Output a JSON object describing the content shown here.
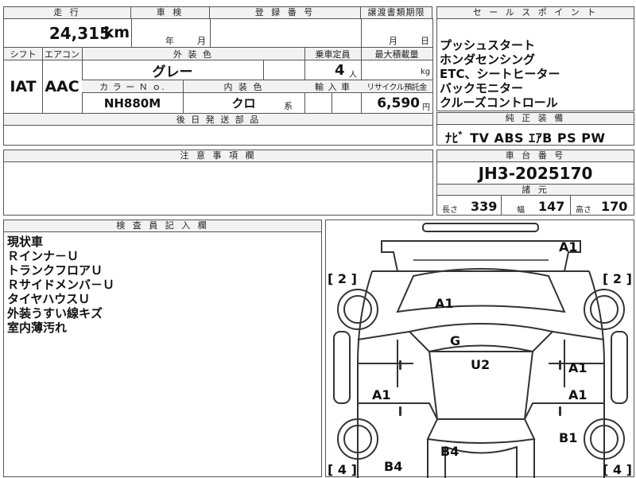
{
  "header": {
    "mileage_label": "走 行",
    "shaken_label": "車 検",
    "reg_label": "登 録 番 号",
    "transfer_label": "譲渡書類期限",
    "sales_point_label": "セ ー ル ス ポ イ ン ト"
  },
  "mileage": {
    "value": "24,315",
    "unit": "km"
  },
  "shaken": {
    "year_unit": "年",
    "month_unit": "月"
  },
  "transfer": {
    "month_unit": "月",
    "day_unit": "日"
  },
  "labels": {
    "shift": "シフト",
    "aircon": "エアコン",
    "exterior_color": "外 装 色",
    "capacity": "乗車定員",
    "max_load": "最大積載量",
    "color_no": "カ ラ ー Ｎ ｏ.",
    "interior_color": "内 装 色",
    "import": "輸 入 車",
    "recycle": "リサイクル預託金",
    "later_parts": "後 日 発 送 部 品",
    "standard_equipment": "純 正 装 備",
    "notes": "注 意 事 項 欄",
    "chassis": "車 台 番 号",
    "specs": "諸 元",
    "inspector": "検 査 員 記 入 欄"
  },
  "vehicle": {
    "shift": "IAT",
    "aircon": "AAC",
    "exterior_color": "グレー",
    "capacity": "4",
    "capacity_unit": "人",
    "max_load_unit": "kg",
    "color_no": "NH880M",
    "interior_color": "クロ",
    "interior_suffix": "系",
    "recycle_fee": "6,590",
    "recycle_unit": "円"
  },
  "sales_points": [
    "プッシュスタート",
    "ホンダセンシング",
    "ETC、シートヒーター",
    "バックモニター",
    "クルーズコントロール"
  ],
  "equipment": "ﾅﾋﾞ TV ABS ｴｱB PS PW",
  "chassis_no": "JH3-2025170",
  "dimensions": {
    "length_label": "長さ",
    "length": "339",
    "width_label": "幅",
    "width": "147",
    "height_label": "高さ",
    "height": "170"
  },
  "inspector_notes": [
    "現状車",
    "Ｒインナ－Ｕ",
    "トランクフロアＵ",
    "Ｒサイドメンバ－Ｕ",
    "タイヤハウスＵ",
    "外装うすい線キズ",
    "室内薄汚れ"
  ],
  "diagram": {
    "marks": {
      "front_top": "A1",
      "hood": "A1",
      "roof_g": "G",
      "roof_u2": "U2",
      "right_front_door": "A1",
      "left_door": "A1",
      "right_rear_door": "A1",
      "right_rear_fender": "B1",
      "rear_center": "B4",
      "rear_left": "B4"
    },
    "tire_left_front": "[ 2 ]",
    "tire_right_front": "[ 2 ]",
    "tire_left_rear": "[ 4 ]",
    "tire_right_rear": "[ 4 ]"
  }
}
